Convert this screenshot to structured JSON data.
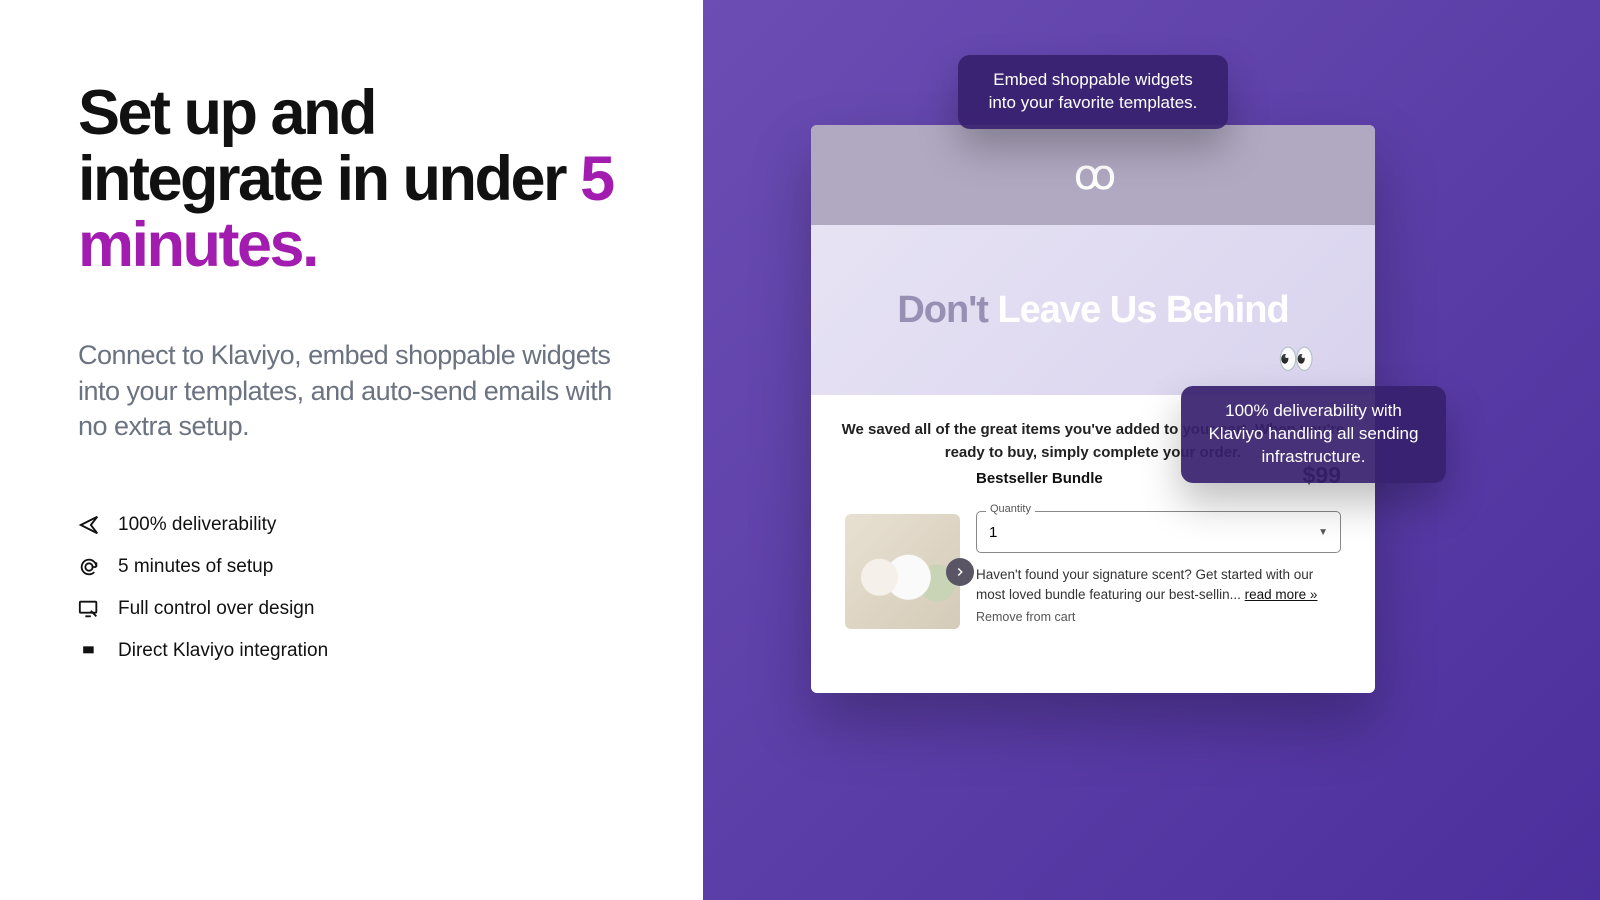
{
  "left": {
    "headline_pre": "Set up and integrate in under ",
    "headline_accent": "5 minutes.",
    "subcopy": "Connect to Klaviyo, embed shoppable widgets into your templates, and auto-send emails with no extra setup."
  },
  "features": [
    {
      "label": "100% deliverability"
    },
    {
      "label": "5 minutes of setup"
    },
    {
      "label": "Full control over design"
    },
    {
      "label": "Direct Klaviyo integration"
    }
  ],
  "callouts": {
    "top": "Embed shoppable widgets into your favorite templates.",
    "right": "100% deliverability with Klaviyo handling all sending infrastructure."
  },
  "email": {
    "hero_muted": "Don't ",
    "hero_light": "Leave Us Behind",
    "eyes": "👀",
    "saved_text": "We saved all of the great items you've added to your cart. When you're ready to buy, simply complete your order.",
    "product": {
      "name": "Bestseller Bundle",
      "price": "$99",
      "qty_label": "Quantity",
      "qty_value": "1",
      "desc_prefix": "Haven't found your signature scent? Get started with our most loved bundle featuring our best-sellin... ",
      "read_more": "read more »",
      "remove": "Remove from cart"
    }
  }
}
